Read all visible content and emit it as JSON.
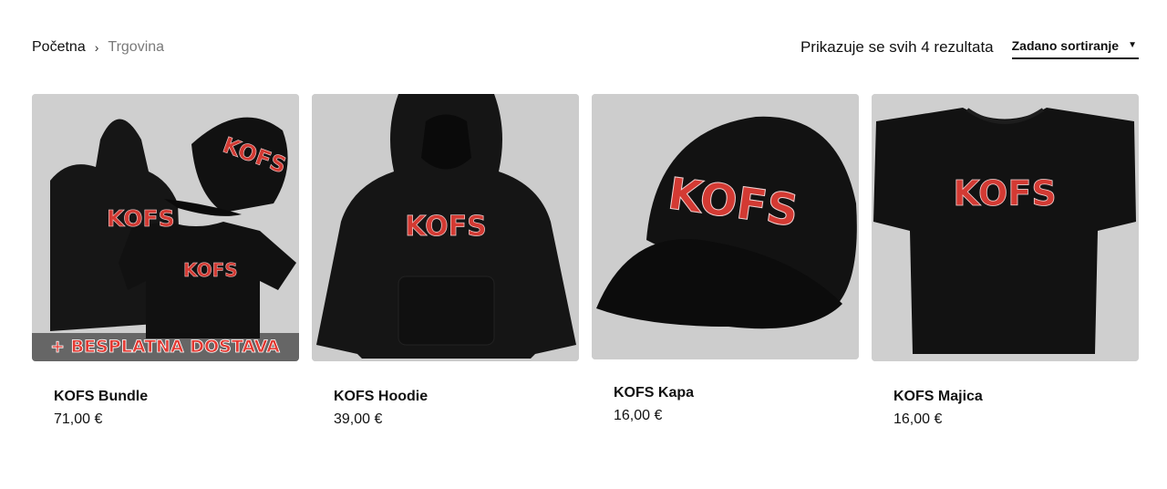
{
  "breadcrumb": {
    "home": "Početna",
    "separator": "›",
    "current": "Trgovina"
  },
  "results": {
    "count_text": "Prikazuje se svih 4 rezultata"
  },
  "sort": {
    "selected": "Zadano sortiranje",
    "caret": "▼"
  },
  "products": [
    {
      "title": "KOFS Bundle",
      "price": "71,00 €",
      "badge": "+ BESPLATNA DOSTAVA",
      "image": "bundle-image"
    },
    {
      "title": "KOFS Hoodie",
      "price": "39,00 €",
      "image": "hoodie-image"
    },
    {
      "title": "KOFS Kapa",
      "price": "16,00 €",
      "image": "cap-image"
    },
    {
      "title": "KOFS Majica",
      "price": "16,00 €",
      "image": "tshirt-image"
    }
  ],
  "brand": {
    "logo_text": "KOFS",
    "logo_color": "#d33a33",
    "garment_color": "#141414"
  }
}
